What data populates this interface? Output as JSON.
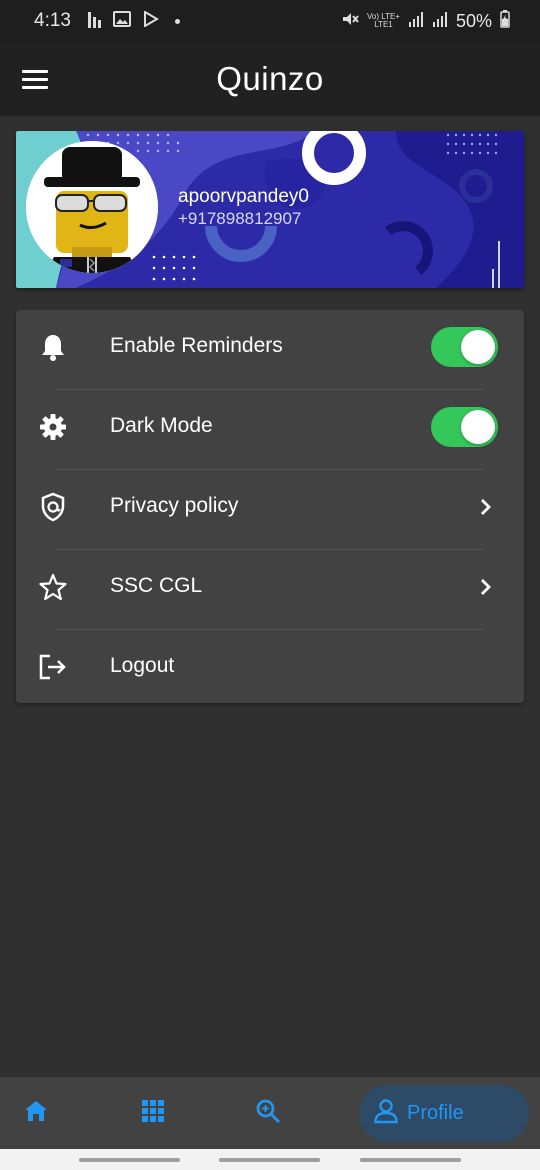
{
  "status_bar": {
    "time": "4:13",
    "network_top": "Vo) LTE+",
    "network_bottom": "LTE1",
    "battery": "50%"
  },
  "app_bar": {
    "title": "Quinzo",
    "menu_icon": "hamburger-menu-icon"
  },
  "profile": {
    "username": "apoorvpandey0",
    "phone": "+917898812907"
  },
  "settings": [
    {
      "label": "Enable Reminders",
      "icon": "bell-icon",
      "control": "toggle",
      "on": true
    },
    {
      "label": "Dark Mode",
      "icon": "gear-icon",
      "control": "toggle",
      "on": true
    },
    {
      "label": "Privacy policy",
      "icon": "shield-icon",
      "control": "chevron"
    },
    {
      "label": "SSC CGL",
      "icon": "star-icon",
      "control": "chevron"
    },
    {
      "label": "Logout",
      "icon": "logout-icon",
      "control": "none"
    }
  ],
  "bottom_nav": {
    "items": [
      {
        "name": "home",
        "icon": "home-icon"
      },
      {
        "name": "apps",
        "icon": "grid-icon"
      },
      {
        "name": "search",
        "icon": "search-icon"
      },
      {
        "name": "profile",
        "icon": "person-icon",
        "label": "Profile",
        "active": true
      }
    ]
  },
  "colors": {
    "background": "#303030",
    "card": "#424242",
    "appbar": "#212121",
    "toggle_on": "#34c759",
    "accent": "#2196f3",
    "banner": "#2d2aa8"
  }
}
